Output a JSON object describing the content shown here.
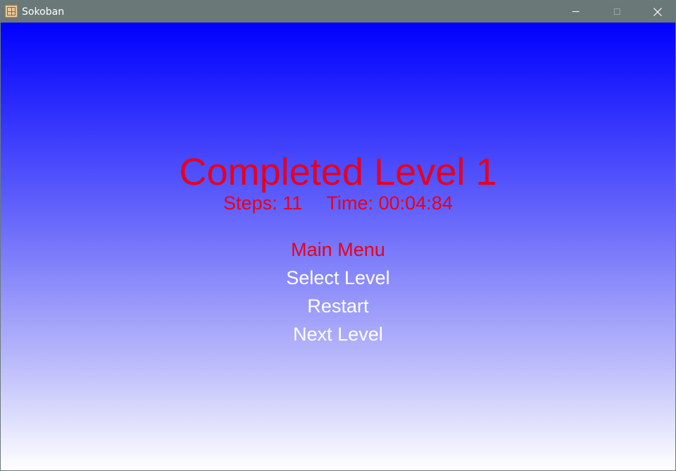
{
  "window": {
    "title": "Sokoban",
    "icon": "sokoban-app-icon",
    "controls": {
      "minimize": "minimize-icon",
      "maximize": "maximize-icon",
      "close": "close-icon"
    }
  },
  "result": {
    "headline": "Completed Level 1",
    "steps_label": "Steps: 11",
    "time_label": "Time: 00:04:84"
  },
  "menu": {
    "items": [
      {
        "label": "Main Menu",
        "selected": true
      },
      {
        "label": "Select Level",
        "selected": false
      },
      {
        "label": "Restart",
        "selected": false
      },
      {
        "label": "Next Level",
        "selected": false
      }
    ]
  },
  "colors": {
    "accent_red": "#e8001c",
    "gradient_top": "#0000ff",
    "gradient_bottom": "#ffffff",
    "titlebar": "#6b7878"
  }
}
